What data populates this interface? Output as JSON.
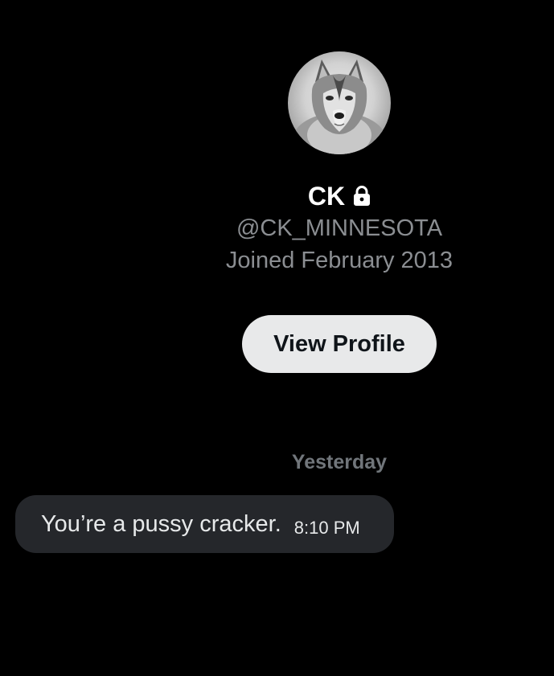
{
  "profile": {
    "avatar_icon": "wolf-avatar-icon",
    "display_name": "CK",
    "protected_icon": "lock-icon",
    "handle": "@CK_MINNESOTA",
    "joined": "Joined February 2013",
    "view_profile_label": "View Profile"
  },
  "conversation": {
    "date_divider": "Yesterday",
    "messages": [
      {
        "text": "You’re a pussy cracker.",
        "time": "8:10 PM"
      }
    ]
  },
  "colors": {
    "background": "#000000",
    "primary_text": "#ffffff",
    "secondary_text": "#8b8e92",
    "button_bg": "#e8e9ea",
    "bubble_bg": "#25272b"
  }
}
